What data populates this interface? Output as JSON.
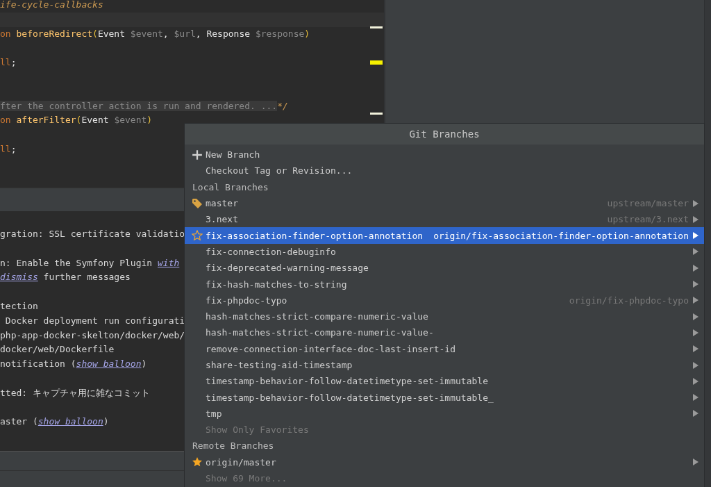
{
  "editor": {
    "lines": [
      {
        "kind": "code",
        "tokens": [
          {
            "kind": "doc",
            "text": "ife-cycle-callbacks"
          }
        ]
      },
      {
        "kind": "blank",
        "current": true
      },
      {
        "kind": "code",
        "tokens": [
          {
            "kind": "keyword",
            "text": "on "
          },
          {
            "kind": "function",
            "text": "beforeRedirect"
          },
          {
            "kind": "paren",
            "text": "("
          },
          {
            "kind": "type",
            "text": "Event "
          },
          {
            "kind": "variable",
            "text": "$event"
          },
          {
            "kind": "type",
            "text": ", "
          },
          {
            "kind": "variable",
            "text": "$url"
          },
          {
            "kind": "type",
            "text": ", Response "
          },
          {
            "kind": "variable",
            "text": "$response"
          },
          {
            "kind": "paren",
            "text": ")"
          }
        ]
      },
      {
        "kind": "blank"
      },
      {
        "kind": "code",
        "tokens": [
          {
            "kind": "keyword",
            "text": "ll"
          },
          {
            "kind": "type",
            "text": ";"
          }
        ]
      },
      {
        "kind": "blank"
      },
      {
        "kind": "blank"
      },
      {
        "kind": "code",
        "tokens": [
          {
            "kind": "folded",
            "text": "fter the controller action is run and rendered. ..."
          },
          {
            "kind": "doc",
            "text": "*/"
          }
        ]
      },
      {
        "kind": "code",
        "tokens": [
          {
            "kind": "keyword",
            "text": "on "
          },
          {
            "kind": "function",
            "text": "afterFilter"
          },
          {
            "kind": "paren",
            "text": "("
          },
          {
            "kind": "type",
            "text": "Event "
          },
          {
            "kind": "variable",
            "text": "$event"
          },
          {
            "kind": "paren",
            "text": ")"
          }
        ]
      },
      {
        "kind": "blank"
      },
      {
        "kind": "code",
        "tokens": [
          {
            "kind": "keyword",
            "text": "ll"
          },
          {
            "kind": "type",
            "text": ";"
          }
        ]
      }
    ]
  },
  "event_log": {
    "entries": [
      [
        [
          {
            "text": "gration: SSL certificate validatio",
            "link": false
          }
        ]
      ],
      [
        [
          {
            "text": "n: Enable the Symfony Plugin ",
            "link": false
          },
          {
            "text": "with",
            "link": true
          }
        ],
        [
          {
            "text": "dismiss",
            "link": true
          },
          {
            "text": " further messages",
            "link": false
          }
        ]
      ],
      [
        [
          {
            "text": "tection",
            "link": false
          }
        ],
        [
          {
            "text": " Docker deployment run configurati",
            "link": false
          }
        ],
        [
          {
            "text": "php-app-docker-skelton/docker/web/",
            "link": false
          }
        ],
        [
          {
            "text": "docker/web/Dockerfile",
            "link": false
          }
        ],
        [
          {
            "text": "notification (",
            "link": false
          },
          {
            "text": "show balloon",
            "link": true
          },
          {
            "text": ")",
            "link": false
          }
        ]
      ],
      [
        [
          {
            "text": "tted: キャプチャ用に雑なコミット",
            "link": false
          }
        ]
      ],
      [
        [
          {
            "text": "aster (",
            "link": false
          },
          {
            "text": "show balloon",
            "link": true
          },
          {
            "text": ")",
            "link": false
          }
        ]
      ]
    ]
  },
  "popup": {
    "title": "Git Branches",
    "items": [
      {
        "kind": "create",
        "label": "New Branch"
      },
      {
        "kind": "action",
        "label": "Checkout Tag or Revision..."
      },
      {
        "kind": "header",
        "label": "Local Branches"
      },
      {
        "kind": "branch",
        "name": "master",
        "tracking": "upstream/master",
        "current": true,
        "favorite": false,
        "selected": false
      },
      {
        "kind": "branch",
        "name": "3.next",
        "tracking": "upstream/3.next",
        "current": false,
        "favorite": false,
        "selected": false
      },
      {
        "kind": "branch",
        "name": "fix-association-finder-option-annotation",
        "tracking": "origin/fix-association-finder-option-annotation",
        "current": false,
        "favorite": false,
        "selected": true
      },
      {
        "kind": "branch",
        "name": "fix-connection-debuginfo",
        "current": false,
        "favorite": false,
        "selected": false
      },
      {
        "kind": "branch",
        "name": "fix-deprecated-warning-message",
        "current": false,
        "favorite": false,
        "selected": false
      },
      {
        "kind": "branch",
        "name": "fix-hash-matches-to-string",
        "current": false,
        "favorite": false,
        "selected": false
      },
      {
        "kind": "branch",
        "name": "fix-phpdoc-typo",
        "tracking": "origin/fix-phpdoc-typo",
        "current": false,
        "favorite": false,
        "selected": false
      },
      {
        "kind": "branch",
        "name": "hash-matches-strict-compare-numeric-value",
        "current": false,
        "favorite": false,
        "selected": false
      },
      {
        "kind": "branch",
        "name": "hash-matches-strict-compare-numeric-value-",
        "current": false,
        "favorite": false,
        "selected": false
      },
      {
        "kind": "branch",
        "name": "remove-connection-interface-doc-last-insert-id",
        "current": false,
        "favorite": false,
        "selected": false
      },
      {
        "kind": "branch",
        "name": "share-testing-aid-timestamp",
        "current": false,
        "favorite": false,
        "selected": false
      },
      {
        "kind": "branch",
        "name": "timestamp-behavior-follow-datetimetype-set-immutable",
        "current": false,
        "favorite": false,
        "selected": false
      },
      {
        "kind": "branch",
        "name": "timestamp-behavior-follow-datetimetype-set-immutable_",
        "current": false,
        "favorite": false,
        "selected": false
      },
      {
        "kind": "branch",
        "name": "tmp",
        "current": false,
        "favorite": false,
        "selected": false
      },
      {
        "kind": "more",
        "label": "Show Only Favorites"
      },
      {
        "kind": "header",
        "label": "Remote Branches"
      },
      {
        "kind": "branch",
        "name": "origin/master",
        "current": false,
        "favorite": true,
        "selected": false
      },
      {
        "kind": "more",
        "label": "Show 69 More..."
      }
    ]
  }
}
